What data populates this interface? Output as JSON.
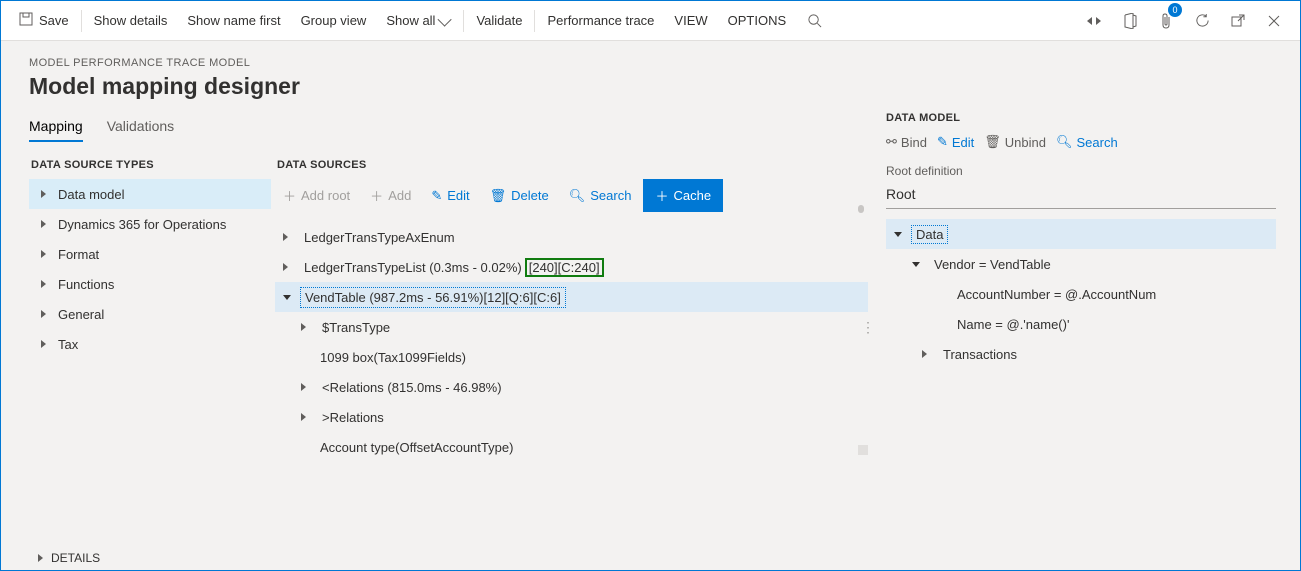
{
  "toolbar": {
    "save": "Save",
    "show_details": "Show details",
    "show_name_first": "Show name first",
    "group_view": "Group view",
    "show_all": "Show all",
    "validate": "Validate",
    "perf_trace": "Performance trace",
    "view": "VIEW",
    "options": "OPTIONS",
    "badge_count": "0"
  },
  "page": {
    "subtitle": "MODEL PERFORMANCE TRACE MODEL",
    "title": "Model mapping designer",
    "tabs": {
      "mapping": "Mapping",
      "validations": "Validations"
    },
    "details": "DETAILS"
  },
  "dst": {
    "header": "DATA SOURCE TYPES",
    "items": [
      "Data model",
      "Dynamics 365 for Operations",
      "Format",
      "Functions",
      "General",
      "Tax"
    ]
  },
  "ds": {
    "header": "DATA SOURCES",
    "toolbar": {
      "add_root": "Add root",
      "add": "Add",
      "edit": "Edit",
      "delete": "Delete",
      "search": "Search",
      "cache": "Cache"
    },
    "rows": [
      {
        "label": "LedgerTransTypeAxEnum",
        "arrow": "right",
        "indent": 0
      },
      {
        "label": "LedgerTransTypeList (0.3ms - 0.02%)",
        "cache": "[240][C:240]",
        "arrow": "right",
        "indent": 0
      },
      {
        "label": "VendTable (987.2ms - 56.91%)[12][Q:6][C:6]",
        "arrow": "down",
        "indent": 0,
        "selected": true,
        "boxed": true
      },
      {
        "label": "$TransType",
        "arrow": "right",
        "indent": 1
      },
      {
        "label": "1099 box(Tax1099Fields)",
        "arrow": "",
        "indent": 1
      },
      {
        "label": "<Relations (815.0ms - 46.98%)",
        "arrow": "right",
        "indent": 1
      },
      {
        "label": ">Relations",
        "arrow": "right",
        "indent": 1
      },
      {
        "label": "Account type(OffsetAccountType)",
        "arrow": "",
        "indent": 1
      }
    ]
  },
  "dm": {
    "header": "DATA MODEL",
    "toolbar": {
      "bind": "Bind",
      "edit": "Edit",
      "unbind": "Unbind",
      "search": "Search"
    },
    "root_def_label": "Root definition",
    "root_def_value": "Root",
    "rows": [
      {
        "label": "Data",
        "arrow": "down",
        "indent": 0,
        "selected": true,
        "boxed": true
      },
      {
        "label": "Vendor = VendTable",
        "arrow": "down",
        "indent": 1
      },
      {
        "label": "AccountNumber = @.AccountNum",
        "arrow": "",
        "indent": 2
      },
      {
        "label": "Name = @.'name()'",
        "arrow": "",
        "indent": 2
      },
      {
        "label": "Transactions",
        "arrow": "right",
        "indent": 2
      }
    ]
  }
}
